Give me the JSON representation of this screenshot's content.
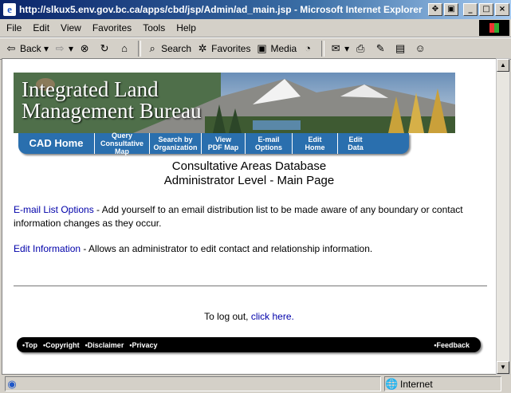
{
  "window": {
    "title": "http://slkux5.env.gov.bc.ca/apps/cbd/jsp/Admin/ad_main.jsp - Microsoft Internet Explorer"
  },
  "menu": [
    "File",
    "Edit",
    "View",
    "Favorites",
    "Tools",
    "Help"
  ],
  "toolbar": {
    "back": "Back",
    "search": "Search",
    "favorites": "Favorites",
    "media": "Media"
  },
  "banner": {
    "line1": "Integrated Land",
    "line2": "Management Bureau"
  },
  "nav": [
    {
      "l1": "CAD Home",
      "l2": ""
    },
    {
      "l1": "Query",
      "l2": "Consultative Map"
    },
    {
      "l1": "Search by",
      "l2": "Organization"
    },
    {
      "l1": "View",
      "l2": "PDF Map"
    },
    {
      "l1": "E-mail",
      "l2": "Options"
    },
    {
      "l1": "Edit",
      "l2": "Home"
    },
    {
      "l1": "Edit",
      "l2": "Data"
    }
  ],
  "heading": {
    "line1": "Consultative Areas Database",
    "line2": "Administrator Level - Main Page"
  },
  "email_link": "E-mail List Options",
  "email_desc": " - Add yourself to an email distribution list to be made aware of any boundary or contact information changes as they occur.",
  "edit_link": "Edit Information",
  "edit_desc": " - Allows an administrator to edit contact and relationship information.",
  "logout": {
    "text": "To log out, ",
    "link": "click here."
  },
  "footer": {
    "top": "•Top",
    "copyright": "•Copyright",
    "disclaimer": "•Disclaimer",
    "privacy": "•Privacy",
    "feedback": "•Feedback"
  },
  "status": {
    "zone": "Internet"
  }
}
